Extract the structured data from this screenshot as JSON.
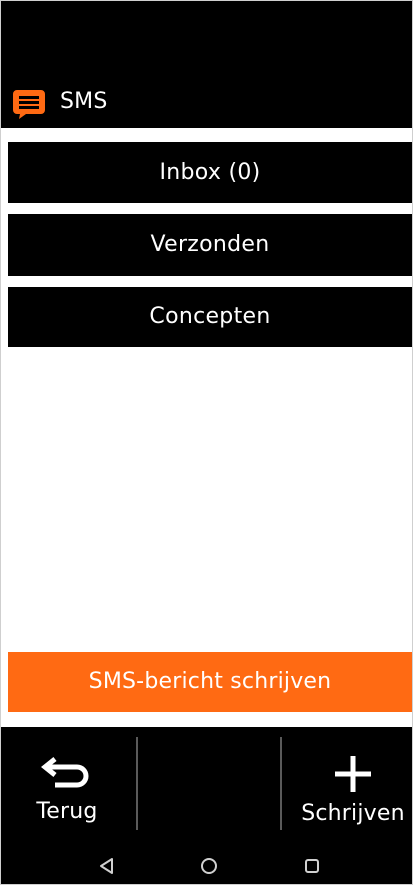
{
  "header": {
    "title": "SMS",
    "icon": "sms-message-icon",
    "icon_color": "#FF6A13"
  },
  "menu": {
    "inbox_label": "Inbox (0)",
    "sent_label": "Verzonden",
    "drafts_label": "Concepten"
  },
  "compose": {
    "label": "SMS-bericht schrijven",
    "color": "#FF6A13"
  },
  "softkeys": {
    "back_label": "Terug",
    "back_icon": "return-arrow-icon",
    "write_label": "Schrijven",
    "write_icon": "plus-icon"
  },
  "navbar": {
    "back_icon": "nav-back-triangle-icon",
    "home_icon": "nav-home-circle-icon",
    "recents_icon": "nav-recents-square-icon"
  }
}
